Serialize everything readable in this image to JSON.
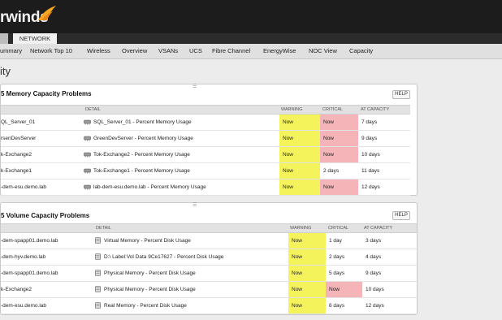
{
  "header": {
    "logo_text": "rwinds"
  },
  "tabs": {
    "network_label": "NETWORK"
  },
  "nav": {
    "items": [
      "ummary",
      "Network Top 10",
      "Wireless",
      "Overview",
      "VSANs",
      "UCS",
      "Fibre Channel",
      "EnergyWise",
      "NOC View",
      "Capacity"
    ]
  },
  "page": {
    "title": "ity"
  },
  "memory_panel": {
    "title": "5 Memory Capacity Problems",
    "help_label": "HELP",
    "columns": {
      "detail": "DETAIL",
      "warning": "WARNING",
      "critical": "CRITICAL",
      "at_capacity": "AT CAPACITY"
    },
    "rows": [
      {
        "node": "QL_Server_01",
        "detail": "SQL_Server_01 - Percent Memory Usage",
        "warning": "Now",
        "critical": "Now",
        "at_capacity": "7 days"
      },
      {
        "node": "rsenDevServer",
        "detail": "GreenDevServer - Percent Memory Usage",
        "warning": "Now",
        "critical": "Now",
        "at_capacity": "9 days"
      },
      {
        "node": "k-Exchange2",
        "detail": "Tok-Exchange2 - Percent Memory Usage",
        "warning": "Now",
        "critical": "Now",
        "at_capacity": "10 days"
      },
      {
        "node": "k-Exchange1",
        "detail": "Tok-Exchange1 - Percent Memory Usage",
        "warning": "Now",
        "critical": "2 days",
        "at_capacity": "11 days"
      },
      {
        "node": "-dem-esu.demo.lab",
        "detail": "lab-dem-esu.demo.lab - Percent Memory Usage",
        "warning": "Now",
        "critical": "Now",
        "at_capacity": "12 days"
      }
    ]
  },
  "volume_panel": {
    "title": "5 Volume Capacity Problems",
    "help_label": "HELP",
    "columns": {
      "detail": "DETAIL",
      "warning": "WARNING",
      "critical": "CRITICAL",
      "at_capacity": "AT CAPACITY"
    },
    "rows": [
      {
        "node": "-dem-spapp01.demo.lab",
        "detail": "Virtual Memory - Percent Disk Usage",
        "warning": "Now",
        "critical": "1 day",
        "at_capacity": "3 days"
      },
      {
        "node": "-dem-hyv.demo.lab",
        "detail": "D:\\ Label:Vol Data 9Ce17627 - Percent Disk Usage",
        "warning": "Now",
        "critical": "2 days",
        "at_capacity": "4 days"
      },
      {
        "node": "-dem-spapp01.demo.lab",
        "detail": "Physical Memory - Percent Disk Usage",
        "warning": "Now",
        "critical": "5 days",
        "at_capacity": "9 days"
      },
      {
        "node": "k-Exchange2",
        "detail": "Physical Memory - Percent Disk Usage",
        "warning": "Now",
        "critical": "Now",
        "at_capacity": "10 days"
      },
      {
        "node": "-dem-esu.demo.lab",
        "detail": "Real Memory - Percent Disk Usage",
        "warning": "Now",
        "critical": "6 days",
        "at_capacity": "12 days"
      }
    ]
  },
  "colors": {
    "warning_bg": "#f4f35c",
    "critical_bg": "#f5b5b8",
    "header_bg": "#1c1c1c",
    "logo_accent": "#f5a623"
  }
}
